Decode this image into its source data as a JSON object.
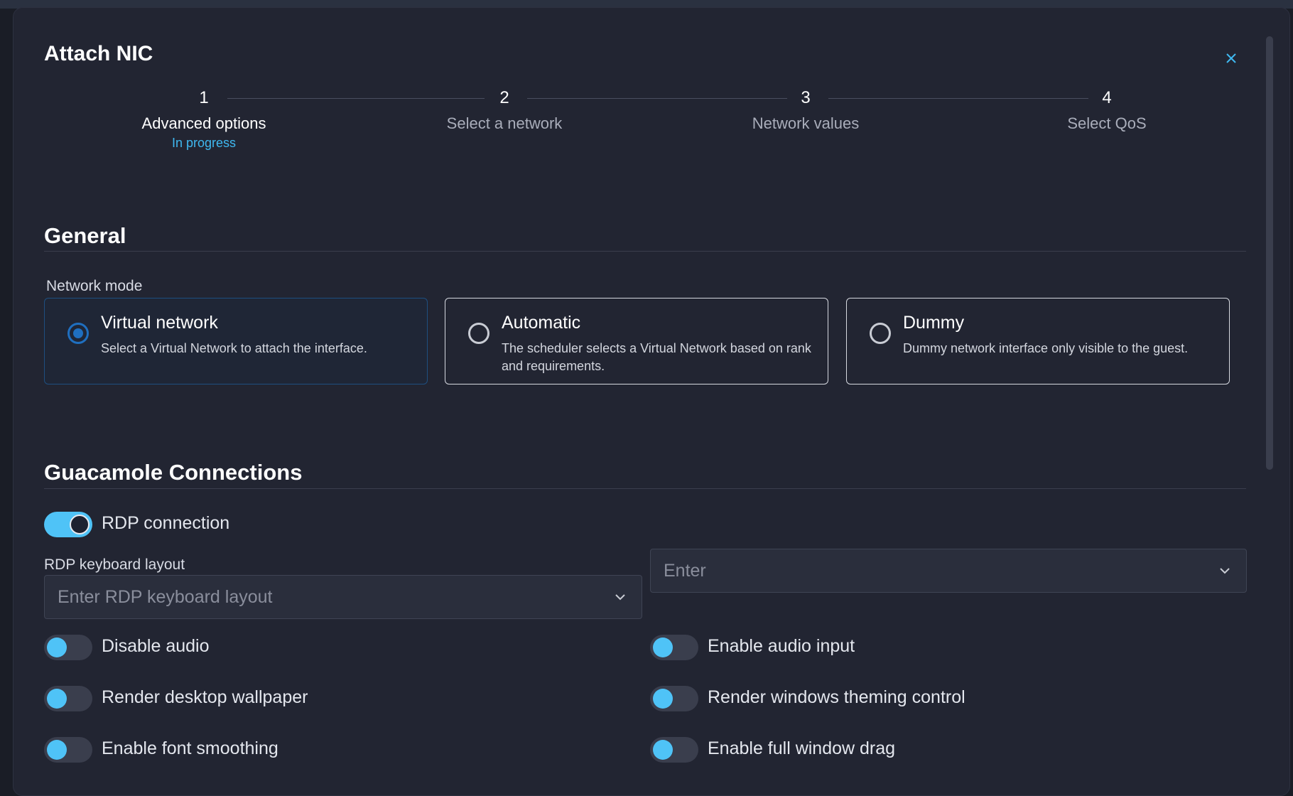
{
  "dialog": {
    "title": "Attach NIC",
    "close_icon": "close-icon"
  },
  "stepper": {
    "steps": [
      {
        "number": "1",
        "label": "Advanced options",
        "status": "In progress"
      },
      {
        "number": "2",
        "label": "Select a network"
      },
      {
        "number": "3",
        "label": "Network values"
      },
      {
        "number": "4",
        "label": "Select QoS"
      }
    ]
  },
  "general": {
    "title": "General",
    "network_mode_label": "Network mode",
    "modes": [
      {
        "title": "Virtual network",
        "description": "Select a Virtual Network to attach the interface.",
        "selected": true
      },
      {
        "title": "Automatic",
        "description": "The scheduler selects a Virtual Network based on rank and requirements.",
        "selected": false
      },
      {
        "title": "Dummy",
        "description": "Dummy network interface only visible to the guest.",
        "selected": false
      }
    ]
  },
  "guacamole": {
    "title": "Guacamole Connections",
    "rdp_connection_label": "RDP connection",
    "rdp_keyboard_label": "RDP keyboard layout",
    "rdp_keyboard_placeholder": "Enter RDP keyboard layout",
    "second_select_placeholder": "Enter",
    "toggles_left": [
      "Disable audio",
      "Render desktop wallpaper",
      "Enable font smoothing"
    ],
    "toggles_right": [
      "Enable audio input",
      "Render windows theming control",
      "Enable full window drag"
    ]
  },
  "colors": {
    "accent": "#4fc3f7",
    "link": "#3fb8f0",
    "background": "#222532",
    "selected_radio": "#1f6fc0"
  }
}
